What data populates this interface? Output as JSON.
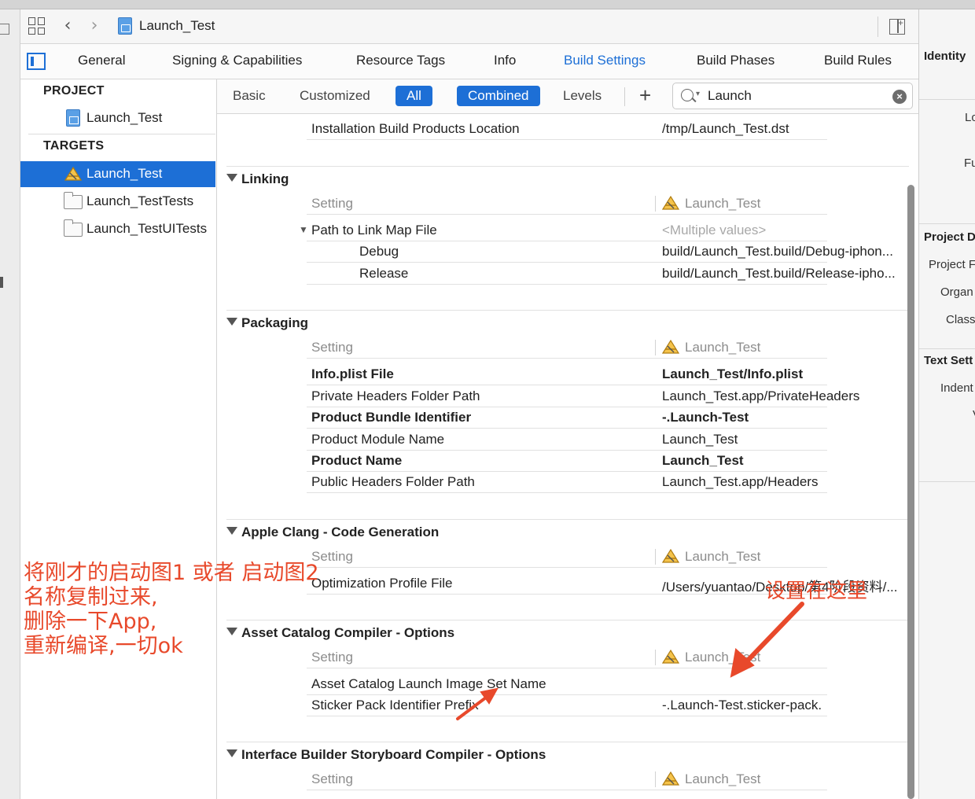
{
  "toolbar": {
    "title": "Launch_Test",
    "icons": [
      "grid-icon",
      "chevron-left-icon",
      "chevron-right-icon",
      "project-file-icon",
      "add-editor-icon"
    ]
  },
  "tabs": [
    "General",
    "Signing & Capabilities",
    "Resource Tags",
    "Info",
    "Build Settings",
    "Build Phases",
    "Build Rules"
  ],
  "active_tab": "Build Settings",
  "navigator": {
    "project_header": "PROJECT",
    "project_item": "Launch_Test",
    "targets_header": "TARGETS",
    "targets": [
      "Launch_Test",
      "Launch_TestTests",
      "Launch_TestUITests"
    ],
    "selected_target": "Launch_Test"
  },
  "filter": {
    "basic": "Basic",
    "customized": "Customized",
    "all": "All",
    "combined": "Combined",
    "levels": "Levels",
    "plus": "+",
    "search_value": "Launch",
    "clear": "×"
  },
  "settings": {
    "top_row": {
      "key": "Installation Build Products Location",
      "value": "/tmp/Launch_Test.dst"
    },
    "column_setting": "Setting",
    "column_target": "Launch_Test",
    "linking": {
      "title": "Linking",
      "path_key": "Path to Link Map File",
      "path_value": "<Multiple values>",
      "debug_key": "Debug",
      "debug_value": "build/Launch_Test.build/Debug-iphon...",
      "release_key": "Release",
      "release_value": "build/Launch_Test.build/Release-ipho..."
    },
    "packaging": {
      "title": "Packaging",
      "rows": [
        {
          "key": "Info.plist File",
          "value": "Launch_Test/Info.plist"
        },
        {
          "key": "Private Headers Folder Path",
          "value": "Launch_Test.app/PrivateHeaders"
        },
        {
          "key": "Product Bundle Identifier",
          "value": "-.Launch-Test"
        },
        {
          "key": "Product Module Name",
          "value": "Launch_Test"
        },
        {
          "key": "Product Name",
          "value": "Launch_Test"
        },
        {
          "key": "Public Headers Folder Path",
          "value": "Launch_Test.app/Headers"
        }
      ]
    },
    "clang": {
      "title": "Apple Clang - Code Generation",
      "row_key": "Optimization Profile File",
      "row_value": "/Users/yuantao/Desktop/第4阶段资料/..."
    },
    "asset": {
      "title": "Asset Catalog Compiler - Options",
      "header_target": "Launch_Test",
      "row1_key": "Asset Catalog Launch Image Set Name",
      "row2_key": "Sticker Pack Identifier Prefix",
      "row2_value": "-.Launch-Test.sticker-pack."
    },
    "ib": {
      "title": "Interface Builder Storyboard Compiler - Options"
    }
  },
  "inspector": {
    "identity": "Identity",
    "lo": "Lo",
    "fu": "Fu",
    "project_d": "Project D",
    "project_f": "Project F",
    "organ": "Organ",
    "class": "Class",
    "text_sett": "Text Sett",
    "indent": "Indent",
    "v": "V"
  },
  "annotations": {
    "note_lines": [
      "将刚才的启动图1 或者 启动图2",
      "名称复制过来,",
      "删除一下App,",
      "重新编译,一切ok"
    ],
    "note_right": "设置在这里",
    "color": "#e8492b"
  },
  "colors": {
    "accent": "#1d6fd6"
  }
}
